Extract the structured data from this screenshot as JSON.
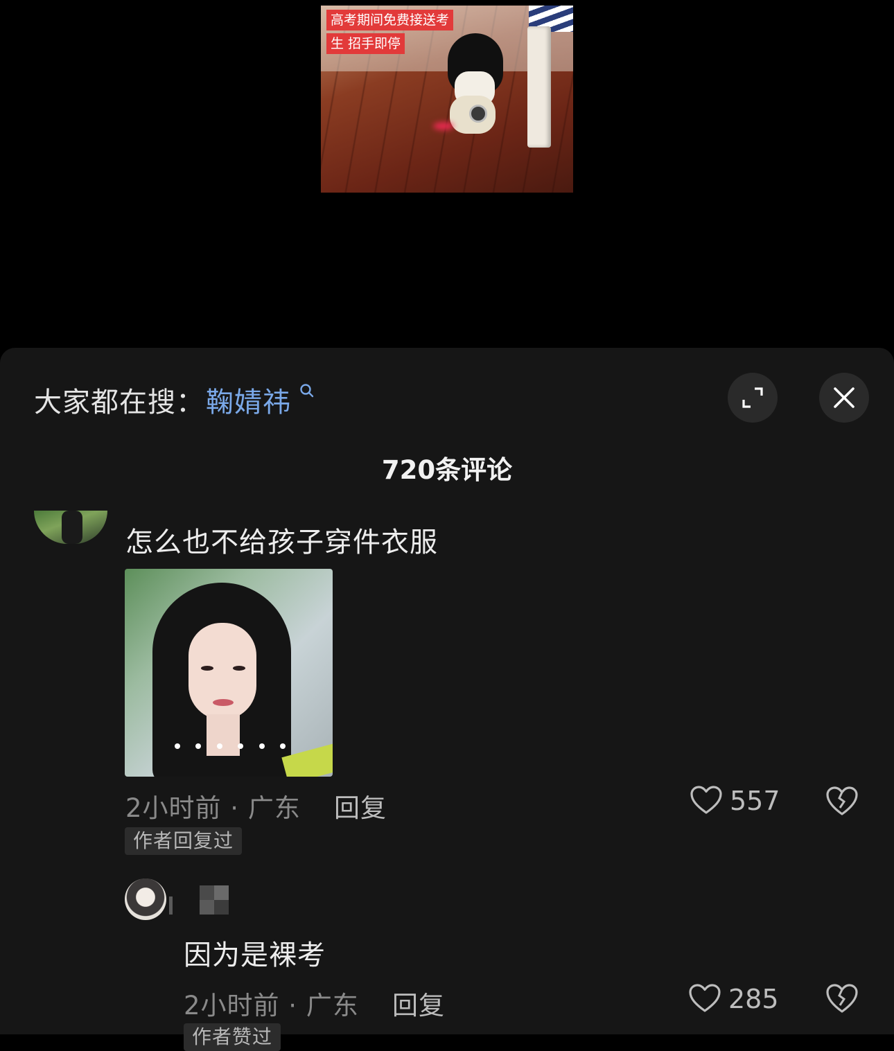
{
  "video": {
    "caption_line1": "高考期间免费接送考",
    "caption_line2": "生 招手即停"
  },
  "header": {
    "search_prefix": "大家都在搜：",
    "search_term": "鞠婧祎",
    "comment_count": "720条评论"
  },
  "comments": [
    {
      "text": "怎么也不给孩子穿件衣服",
      "meta": "2小时前 · 广东",
      "reply_label": "回复",
      "likes": "557",
      "badge": "作者回复过"
    },
    {
      "text": "因为是裸考",
      "meta": "2小时前 · 广东",
      "reply_label": "回复",
      "likes": "285",
      "badge": "作者赞过"
    }
  ],
  "icons": {
    "search": "search-icon",
    "expand": "expand-icon",
    "close": "close-icon",
    "like": "heart-icon",
    "dislike": "broken-heart-icon"
  },
  "colors": {
    "accent_link": "#7aa8e8",
    "caption_bg": "#e23a3a",
    "sheet_bg": "#161616"
  }
}
